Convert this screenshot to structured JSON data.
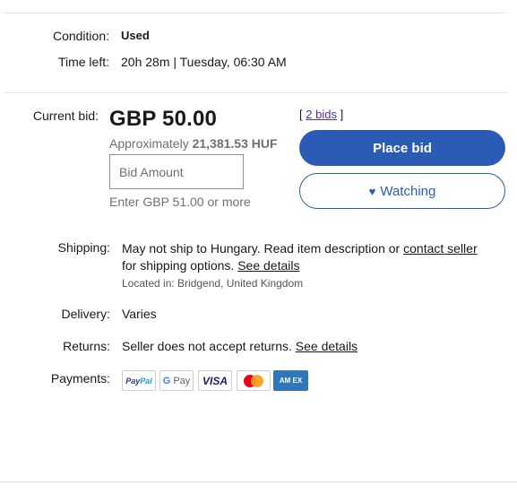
{
  "condition": {
    "label": "Condition:",
    "value": "Used"
  },
  "time_left": {
    "label": "Time left:",
    "value": "20h 28m | Tuesday, 06:30 AM"
  },
  "current_bid": {
    "label": "Current bid:",
    "price": "GBP 50.00",
    "approx_prefix": "Approximately",
    "approx_value": "21,381.53 HUF",
    "bid_placeholder": "Bid Amount",
    "enter_hint": "Enter GBP 51.00 or more",
    "bids_link": "2 bids",
    "bracket_open": "[",
    "bracket_close": "]"
  },
  "buttons": {
    "place_bid": "Place bid",
    "watching": "Watching",
    "watching_icon": "heart-icon"
  },
  "shipping": {
    "label": "Shipping:",
    "text_1": "May not ship to Hungary. Read item description or",
    "link_contact": "contact seller",
    "text_2": "for shipping options.",
    "link_details": "See details",
    "located": "Located in: Bridgend, United Kingdom"
  },
  "delivery": {
    "label": "Delivery:",
    "value": "Varies"
  },
  "returns": {
    "label": "Returns:",
    "text": "Seller does not accept returns.",
    "link_details": "See details"
  },
  "payments": {
    "label": "Payments:",
    "methods": [
      {
        "name": "PayPal",
        "text_a": "Pay",
        "text_b": "Pal"
      },
      {
        "name": "Google Pay",
        "text_g": "G",
        "text": "Pay"
      },
      {
        "name": "Visa",
        "text": "VISA"
      },
      {
        "name": "Mastercard"
      },
      {
        "name": "American Express",
        "text": "AM EX"
      }
    ]
  },
  "colors": {
    "primary": "#2b5bb5",
    "link_purple": "#5a2dab",
    "secondary_text": "#707070",
    "mc_red": "#eb001b",
    "mc_yellow": "#f79e1b"
  }
}
